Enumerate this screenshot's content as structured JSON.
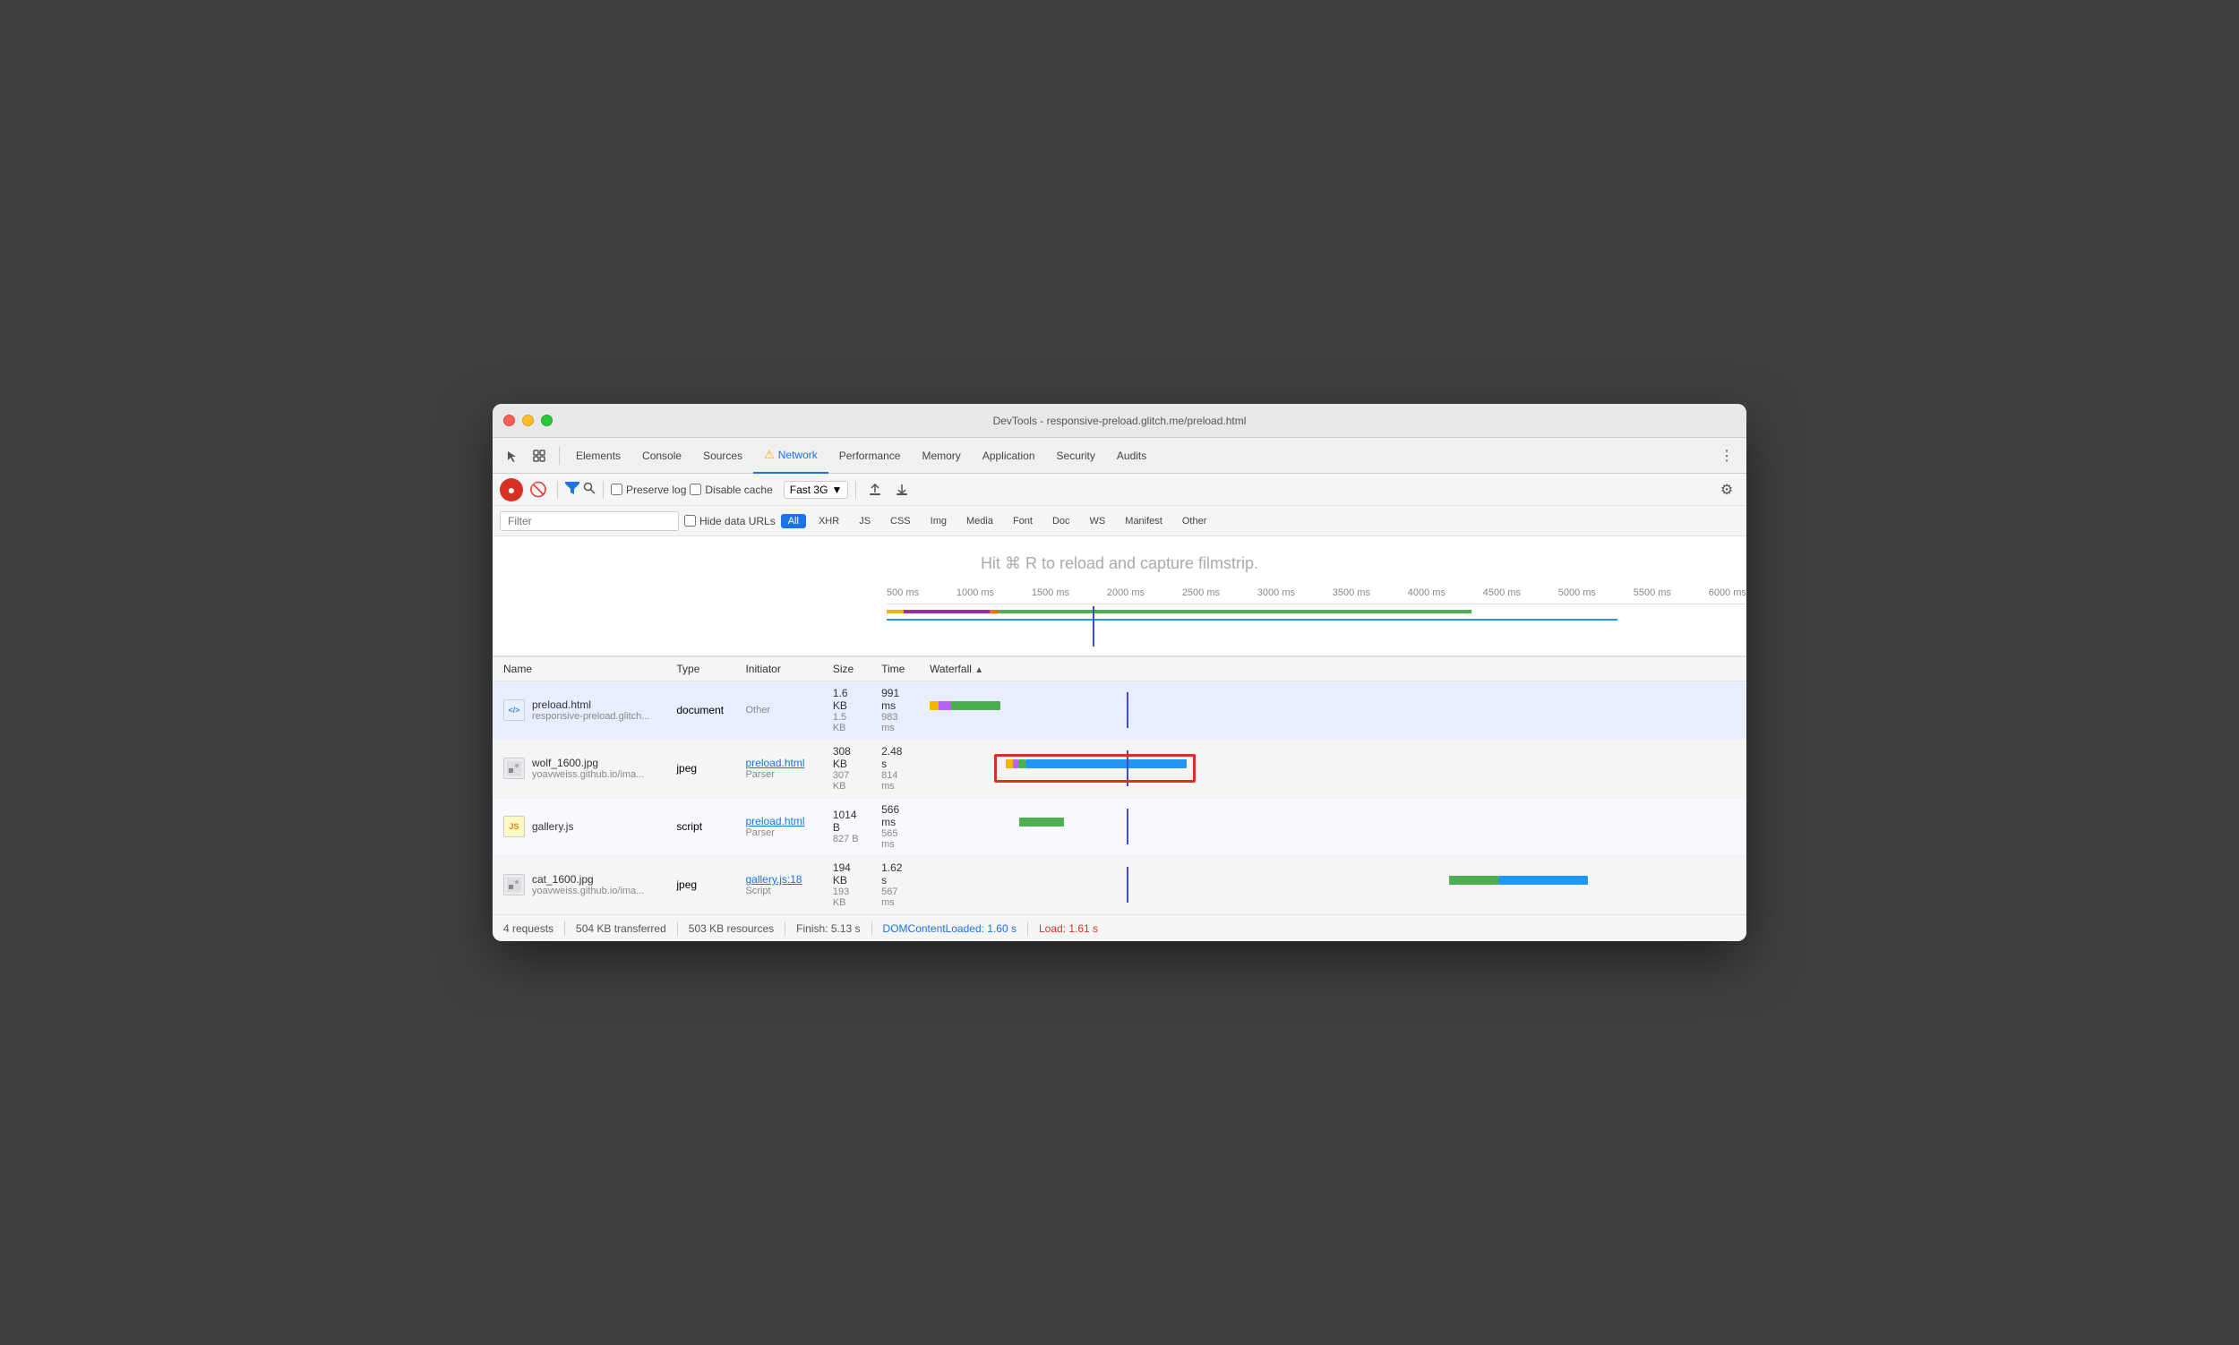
{
  "window": {
    "title": "DevTools - responsive-preload.glitch.me/preload.html"
  },
  "tabs": {
    "items": [
      {
        "label": "Elements",
        "active": false
      },
      {
        "label": "Console",
        "active": false
      },
      {
        "label": "Sources",
        "active": false
      },
      {
        "label": "Network",
        "active": true,
        "warn": true
      },
      {
        "label": "Performance",
        "active": false
      },
      {
        "label": "Memory",
        "active": false
      },
      {
        "label": "Application",
        "active": false
      },
      {
        "label": "Security",
        "active": false
      },
      {
        "label": "Audits",
        "active": false
      }
    ]
  },
  "toolbar": {
    "preserve_log_label": "Preserve log",
    "disable_cache_label": "Disable cache",
    "throttle_label": "Fast 3G",
    "filter_placeholder": "Filter"
  },
  "filter_types": [
    "All",
    "XHR",
    "JS",
    "CSS",
    "Img",
    "Media",
    "Font",
    "Doc",
    "WS",
    "Manifest",
    "Other"
  ],
  "filmstrip_text": "Hit ⌘ R to reload and capture filmstrip.",
  "timeline": {
    "ruler": [
      "500 ms",
      "1000 ms",
      "1500 ms",
      "2000 ms",
      "2500 ms",
      "3000 ms",
      "3500 ms",
      "4000 ms",
      "4500 ms",
      "5000 ms",
      "5500 ms",
      "6000 ms"
    ]
  },
  "table": {
    "headers": [
      "Name",
      "Type",
      "Initiator",
      "Size",
      "Time",
      "Waterfall"
    ],
    "rows": [
      {
        "name": "preload.html",
        "url": "responsive-preload.glitch...",
        "type": "document",
        "initiator": "Other",
        "initiator_link": null,
        "size_main": "1.6 KB",
        "size_sub": "1.5 KB",
        "time_main": "991 ms",
        "time_sub": "983 ms",
        "icon_type": "html"
      },
      {
        "name": "wolf_1600.jpg",
        "url": "yoavweiss.github.io/ima...",
        "type": "jpeg",
        "initiator": "preload.html",
        "initiator_sub": "Parser",
        "size_main": "308 KB",
        "size_sub": "307 KB",
        "time_main": "2.48 s",
        "time_sub": "814 ms",
        "icon_type": "jpg"
      },
      {
        "name": "gallery.js",
        "url": "",
        "type": "script",
        "initiator": "preload.html",
        "initiator_sub": "Parser",
        "size_main": "1014 B",
        "size_sub": "827 B",
        "time_main": "566 ms",
        "time_sub": "565 ms",
        "icon_type": "js"
      },
      {
        "name": "cat_1600.jpg",
        "url": "yoavweiss.github.io/ima...",
        "type": "jpeg",
        "initiator": "gallery.js:18",
        "initiator_sub": "Script",
        "size_main": "194 KB",
        "size_sub": "193 KB",
        "time_main": "1.62 s",
        "time_sub": "567 ms",
        "icon_type": "jpg"
      }
    ]
  },
  "status_bar": {
    "requests": "4 requests",
    "transferred": "504 KB transferred",
    "resources": "503 KB resources",
    "finish": "Finish: 5.13 s",
    "dom_content_loaded": "DOMContentLoaded: 1.60 s",
    "load": "Load: 1.61 s"
  }
}
